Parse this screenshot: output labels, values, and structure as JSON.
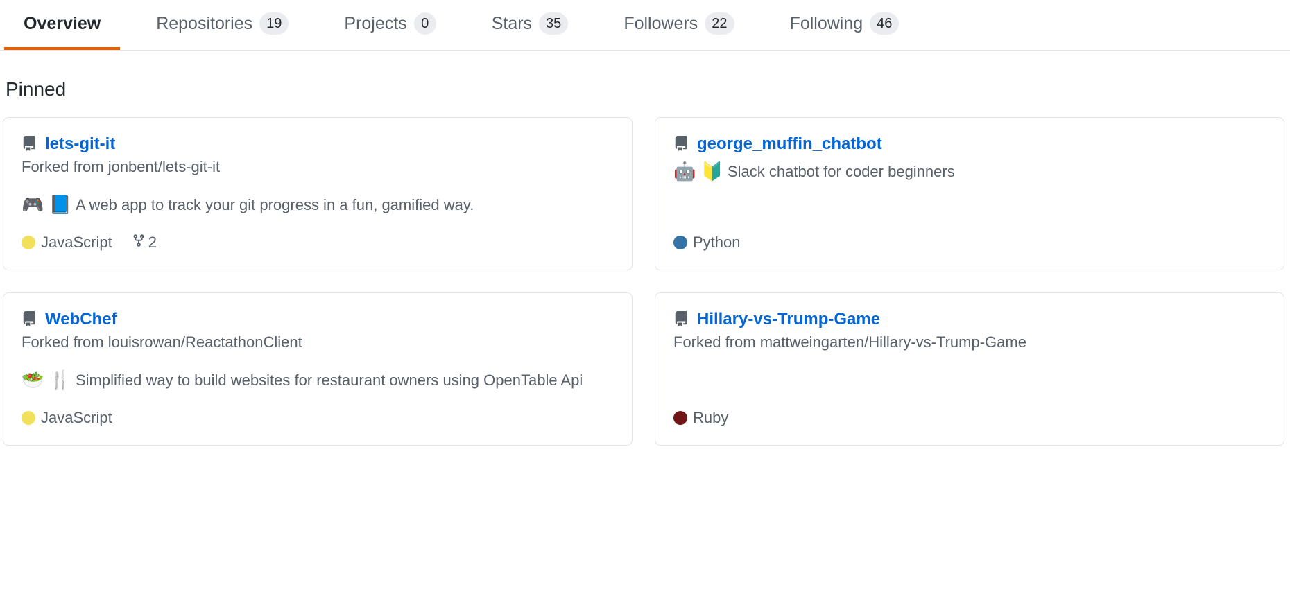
{
  "tabs": [
    {
      "label": "Overview",
      "count": null,
      "active": true
    },
    {
      "label": "Repositories",
      "count": "19",
      "active": false
    },
    {
      "label": "Projects",
      "count": "0",
      "active": false
    },
    {
      "label": "Stars",
      "count": "35",
      "active": false
    },
    {
      "label": "Followers",
      "count": "22",
      "active": false
    },
    {
      "label": "Following",
      "count": "46",
      "active": false
    }
  ],
  "section_heading": "Pinned",
  "lang_colors": {
    "JavaScript": "#f1e05a",
    "Python": "#3572A5",
    "Ruby": "#701516"
  },
  "pinned": [
    {
      "name": "lets-git-it",
      "forked_from": "Forked from jonbent/lets-git-it",
      "desc_emojis": "🎮 📘",
      "description": "A web app to track your git progress in a fun, gamified way.",
      "language": "JavaScript",
      "forks": "2"
    },
    {
      "name": "george_muffin_chatbot",
      "forked_from": null,
      "desc_emojis": "🤖 🔰",
      "description": "Slack chatbot for coder beginners",
      "language": "Python",
      "forks": null
    },
    {
      "name": "WebChef",
      "forked_from": "Forked from louisrowan/ReactathonClient",
      "desc_emojis": "🥗 🍴",
      "description": "Simplified way to build websites for restaurant owners using OpenTable Api",
      "language": "JavaScript",
      "forks": null
    },
    {
      "name": "Hillary-vs-Trump-Game",
      "forked_from": "Forked from mattweingarten/Hillary-vs-Trump-Game",
      "desc_emojis": "",
      "description": "",
      "language": "Ruby",
      "forks": null
    }
  ]
}
